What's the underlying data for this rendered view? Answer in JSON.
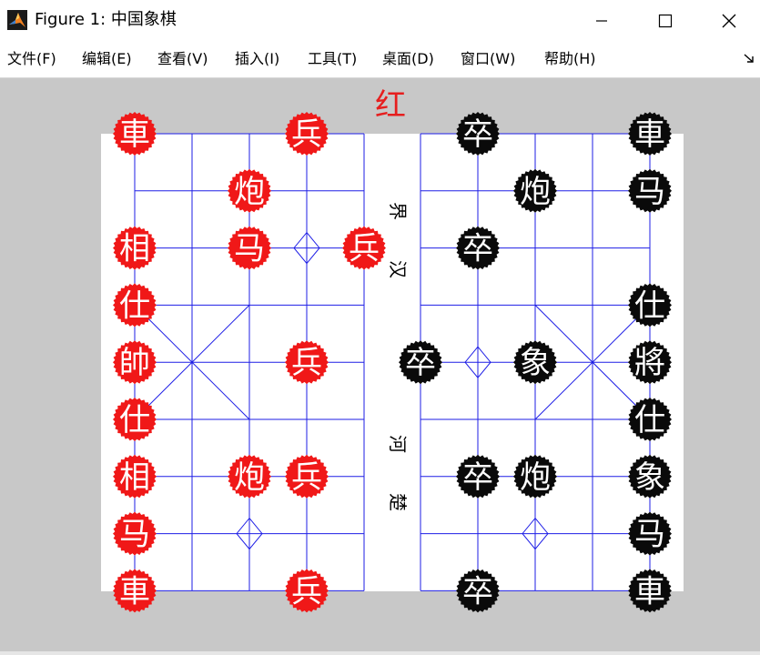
{
  "window": {
    "title": "Figure 1: 中国象棋",
    "controls": [
      "minimize",
      "maximize",
      "close"
    ]
  },
  "menu": [
    {
      "label": "文件(F)"
    },
    {
      "label": "编辑(E)"
    },
    {
      "label": "查看(V)"
    },
    {
      "label": "插入(I)"
    },
    {
      "label": "工具(T)"
    },
    {
      "label": "桌面(D)"
    },
    {
      "label": "窗口(W)"
    },
    {
      "label": "帮助(H)"
    }
  ],
  "board": {
    "turn_label": "红",
    "turn_color": "#e61e1e",
    "river_left": [
      "界",
      "汉"
    ],
    "river_right": [
      "河",
      "楚"
    ],
    "line_color": "#1e1ee6",
    "red_color": "#f01818",
    "black_color": "#0a0a0a",
    "red_pieces": [
      {
        "label": "車",
        "col": 0,
        "row": 0
      },
      {
        "label": "兵",
        "col": 3,
        "row": 0
      },
      {
        "label": "炮",
        "col": 2,
        "row": 1
      },
      {
        "label": "相",
        "col": 0,
        "row": 2
      },
      {
        "label": "马",
        "col": 2,
        "row": 2
      },
      {
        "label": "兵",
        "col": 4,
        "row": 2
      },
      {
        "label": "仕",
        "col": 0,
        "row": 3
      },
      {
        "label": "帥",
        "col": 0,
        "row": 4
      },
      {
        "label": "兵",
        "col": 3,
        "row": 4
      },
      {
        "label": "仕",
        "col": 0,
        "row": 5
      },
      {
        "label": "相",
        "col": 0,
        "row": 6
      },
      {
        "label": "炮",
        "col": 2,
        "row": 6
      },
      {
        "label": "兵",
        "col": 3,
        "row": 6
      },
      {
        "label": "马",
        "col": 0,
        "row": 7
      },
      {
        "label": "車",
        "col": 0,
        "row": 8
      },
      {
        "label": "兵",
        "col": 3,
        "row": 8
      }
    ],
    "black_pieces": [
      {
        "label": "卒",
        "col": 6,
        "row": 0
      },
      {
        "label": "車",
        "col": 9,
        "row": 0
      },
      {
        "label": "炮",
        "col": 7,
        "row": 1
      },
      {
        "label": "马",
        "col": 9,
        "row": 1
      },
      {
        "label": "卒",
        "col": 6,
        "row": 2
      },
      {
        "label": "仕",
        "col": 9,
        "row": 3
      },
      {
        "label": "卒",
        "col": 5,
        "row": 4
      },
      {
        "label": "象",
        "col": 7,
        "row": 4
      },
      {
        "label": "將",
        "col": 9,
        "row": 4
      },
      {
        "label": "仕",
        "col": 9,
        "row": 5
      },
      {
        "label": "卒",
        "col": 6,
        "row": 6
      },
      {
        "label": "炮",
        "col": 7,
        "row": 6
      },
      {
        "label": "象",
        "col": 9,
        "row": 6
      },
      {
        "label": "马",
        "col": 9,
        "row": 7
      },
      {
        "label": "卒",
        "col": 6,
        "row": 8
      },
      {
        "label": "車",
        "col": 9,
        "row": 8
      }
    ]
  }
}
